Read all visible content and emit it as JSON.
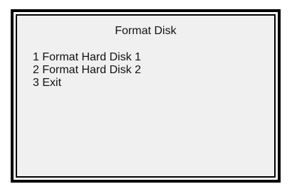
{
  "screen": {
    "title": "Format Disk",
    "menu": [
      {
        "label": "1 Format Hard Disk 1"
      },
      {
        "label": "2 Format Hard Disk 2"
      },
      {
        "label": "3 Exit"
      }
    ]
  }
}
